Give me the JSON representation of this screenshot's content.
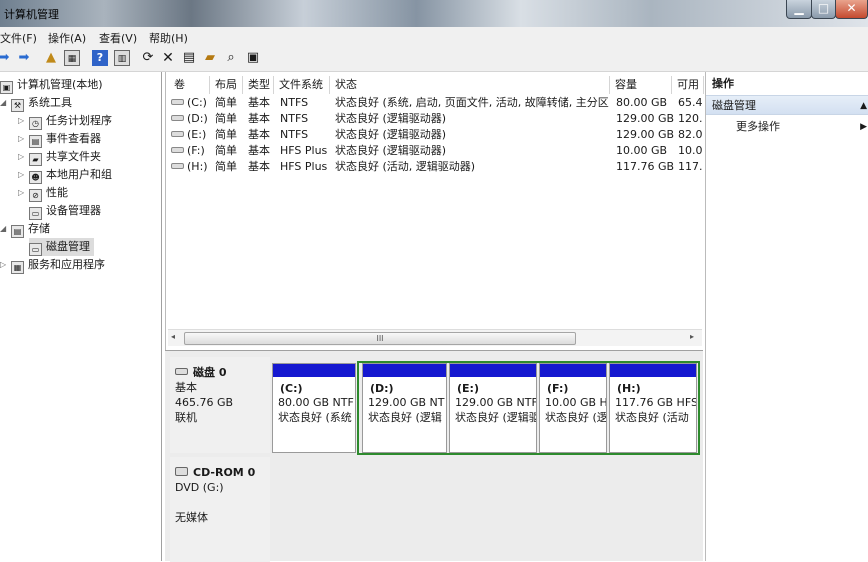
{
  "window": {
    "title": "计算机管理"
  },
  "menu": {
    "file": "文件(F)",
    "action": "操作(A)",
    "view": "查看(V)",
    "help": "帮助(H)"
  },
  "tree": {
    "root": "计算机管理(本地)",
    "system_tools": "系统工具",
    "task_scheduler": "任务计划程序",
    "event_viewer": "事件查看器",
    "shared_folders": "共享文件夹",
    "local_users": "本地用户和组",
    "performance": "性能",
    "device_manager": "设备管理器",
    "storage": "存储",
    "disk_management": "磁盘管理",
    "services_apps": "服务和应用程序"
  },
  "volume_list": {
    "headers": [
      "卷",
      "布局",
      "类型",
      "文件系统",
      "状态",
      "容量",
      "可用"
    ],
    "rows": [
      [
        "(C:)",
        "简单",
        "基本",
        "NTFS",
        "状态良好 (系统, 启动, 页面文件, 活动, 故障转储, 主分区)",
        "80.00 GB",
        "65.4"
      ],
      [
        "(D:)",
        "简单",
        "基本",
        "NTFS",
        "状态良好 (逻辑驱动器)",
        "129.00 GB",
        "120."
      ],
      [
        "(E:)",
        "简单",
        "基本",
        "NTFS",
        "状态良好 (逻辑驱动器)",
        "129.00 GB",
        "82.0"
      ],
      [
        "(F:)",
        "简单",
        "基本",
        "HFS Plus",
        "状态良好 (逻辑驱动器)",
        "10.00 GB",
        "10.0"
      ],
      [
        "(H:)",
        "简单",
        "基本",
        "HFS Plus",
        "状态良好 (活动, 逻辑驱动器)",
        "117.76 GB",
        "117."
      ]
    ]
  },
  "scroll": {
    "thumb_grip": "III"
  },
  "disk0": {
    "name": "磁盘 0",
    "type": "基本",
    "size": "465.76 GB",
    "status": "联机",
    "partitions": [
      {
        "name": "(C:)",
        "size": "80.00 GB NTF",
        "status": "状态良好 (系统"
      },
      {
        "name": "(D:)",
        "size": "129.00 GB NT",
        "status": "状态良好 (逻辑"
      },
      {
        "name": "(E:)",
        "size": "129.00 GB NTF",
        "status": "状态良好 (逻辑驱"
      },
      {
        "name": "(F:)",
        "size": "10.00 GB H",
        "status": "状态良好 (逻"
      },
      {
        "name": "(H:)",
        "size": "117.76 GB HFS",
        "status": "状态良好 (活动"
      }
    ]
  },
  "cdrom": {
    "name": "CD-ROM 0",
    "drive": "DVD (G:)",
    "media": "无媒体"
  },
  "actions": {
    "header": "操作",
    "section": "磁盘管理",
    "more": "更多操作"
  },
  "colors": {
    "primary_partition_bar": "#1518d0",
    "extended_partition_border": "#2d8a2d",
    "logical_partition_bar": "#1518d0"
  }
}
